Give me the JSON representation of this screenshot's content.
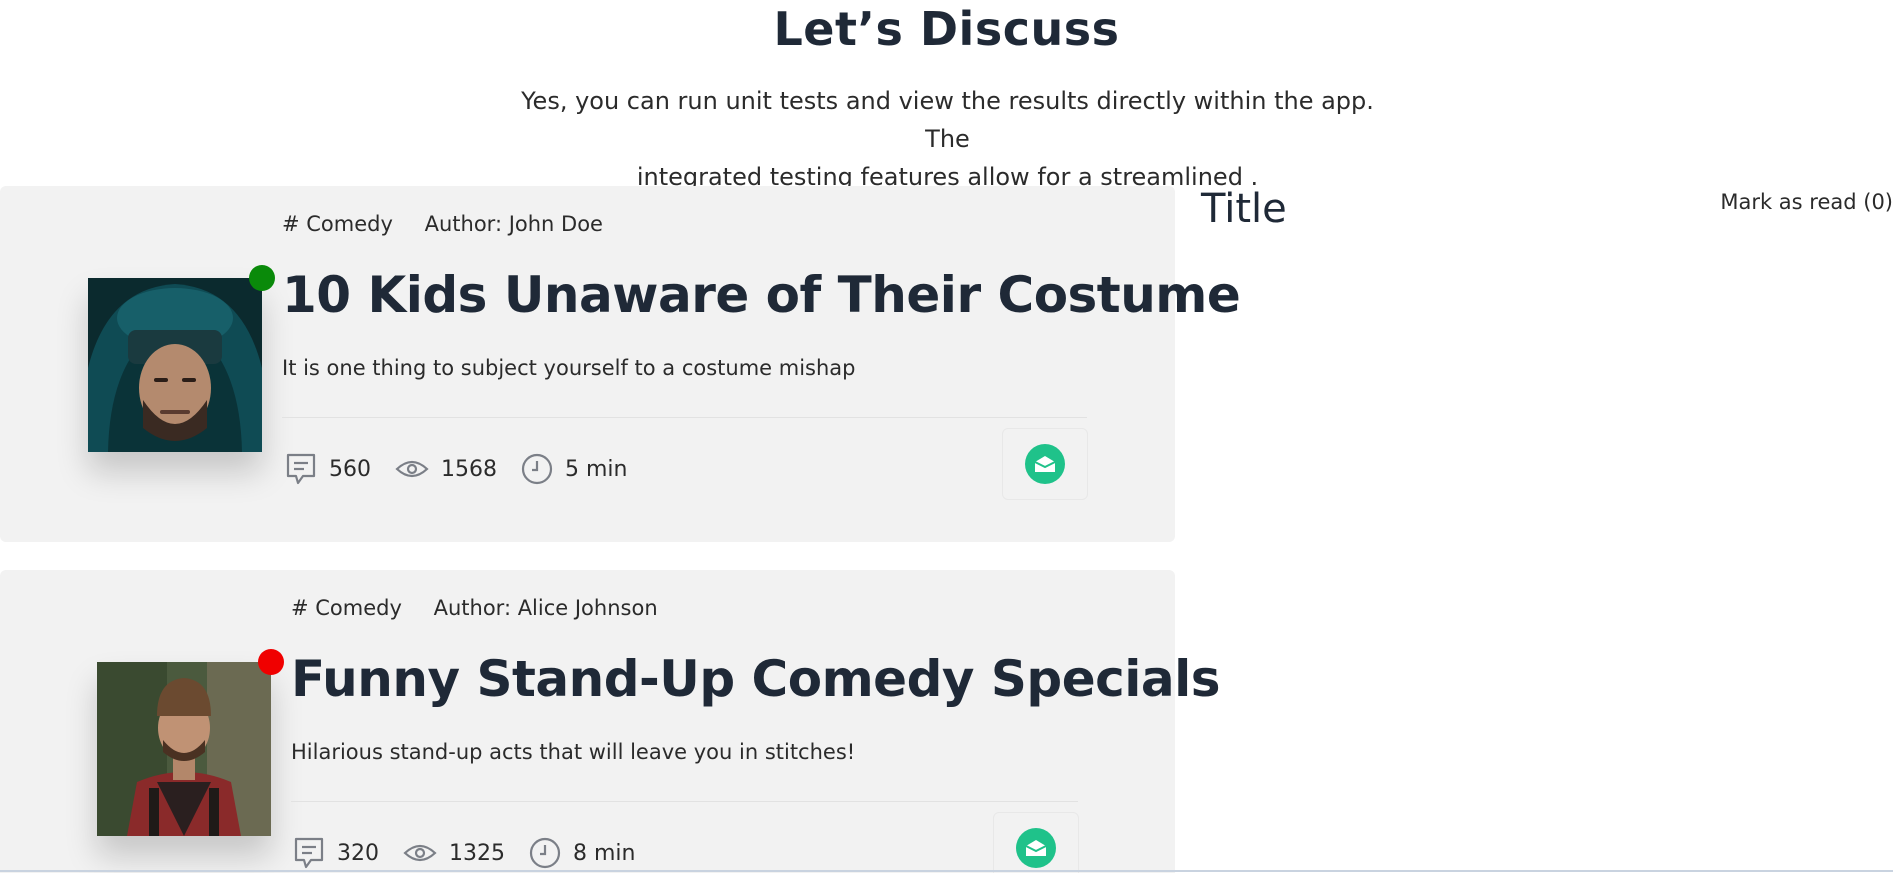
{
  "header": {
    "title": "Let’s Discuss",
    "intro_line1": "Yes, you can run unit tests and view the results directly within the app. The",
    "intro_line2": "integrated testing features allow for a streamlined ."
  },
  "sidebar": {
    "title": "Title",
    "mark_as_read_label": "Mark as read (0)"
  },
  "posts": [
    {
      "category": "# Comedy",
      "author": "Author: John Doe",
      "title": "10 Kids Unaware of Their Costume",
      "description": "It is one thing to subject yourself to a costume mishap",
      "comments": "560",
      "views": "1568",
      "read_time": "5 min",
      "status_color": "#0a8a0a",
      "avatar_icon": "avatar-hooded-man"
    },
    {
      "category": "# Comedy",
      "author": "Author: Alice Johnson",
      "title": "Funny Stand-Up Comedy Specials",
      "description": "Hilarious stand-up acts that will leave you in stitches!",
      "comments": "320",
      "views": "1325",
      "read_time": "8 min",
      "status_color": "#f00000",
      "avatar_icon": "avatar-beanie-man"
    }
  ],
  "colors": {
    "accent": "#1fc28a",
    "card_bg": "#f2f2f2",
    "text": "#1f2937"
  }
}
